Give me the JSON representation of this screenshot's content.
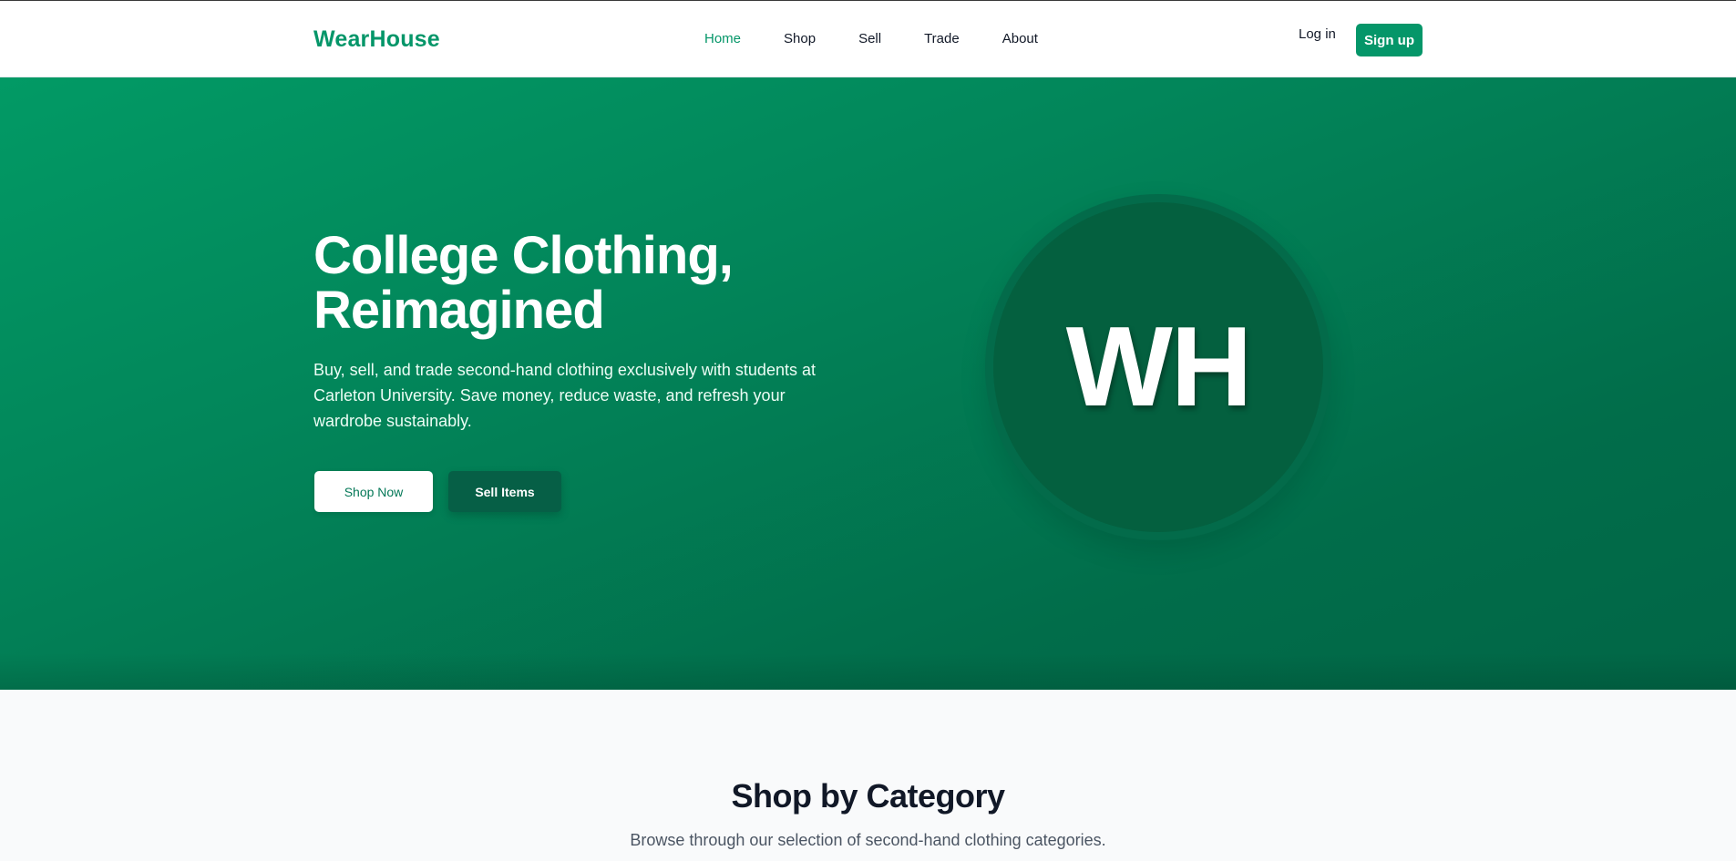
{
  "navbar": {
    "brand": "WearHouse",
    "links": [
      {
        "label": "Home",
        "active": true
      },
      {
        "label": "Shop",
        "active": false
      },
      {
        "label": "Sell",
        "active": false
      },
      {
        "label": "Trade",
        "active": false
      },
      {
        "label": "About",
        "active": false
      }
    ],
    "login_label": "Log in",
    "signup_label": "Sign up"
  },
  "hero": {
    "title_line1": "College Clothing,",
    "title_line2": "Reimagined",
    "subtitle": "Buy, sell, and trade second-hand clothing exclusively with students at Carleton University. Save money, reduce waste, and refresh your wardrobe sustainably.",
    "shop_now_label": "Shop Now",
    "sell_items_label": "Sell Items",
    "logo_text": "WH"
  },
  "category": {
    "title": "Shop by Category",
    "subtitle": "Browse through our selection of second-hand clothing categories."
  },
  "colors": {
    "brand": "#059669",
    "hero_dark": "#065f46",
    "text_dark": "#111827"
  }
}
